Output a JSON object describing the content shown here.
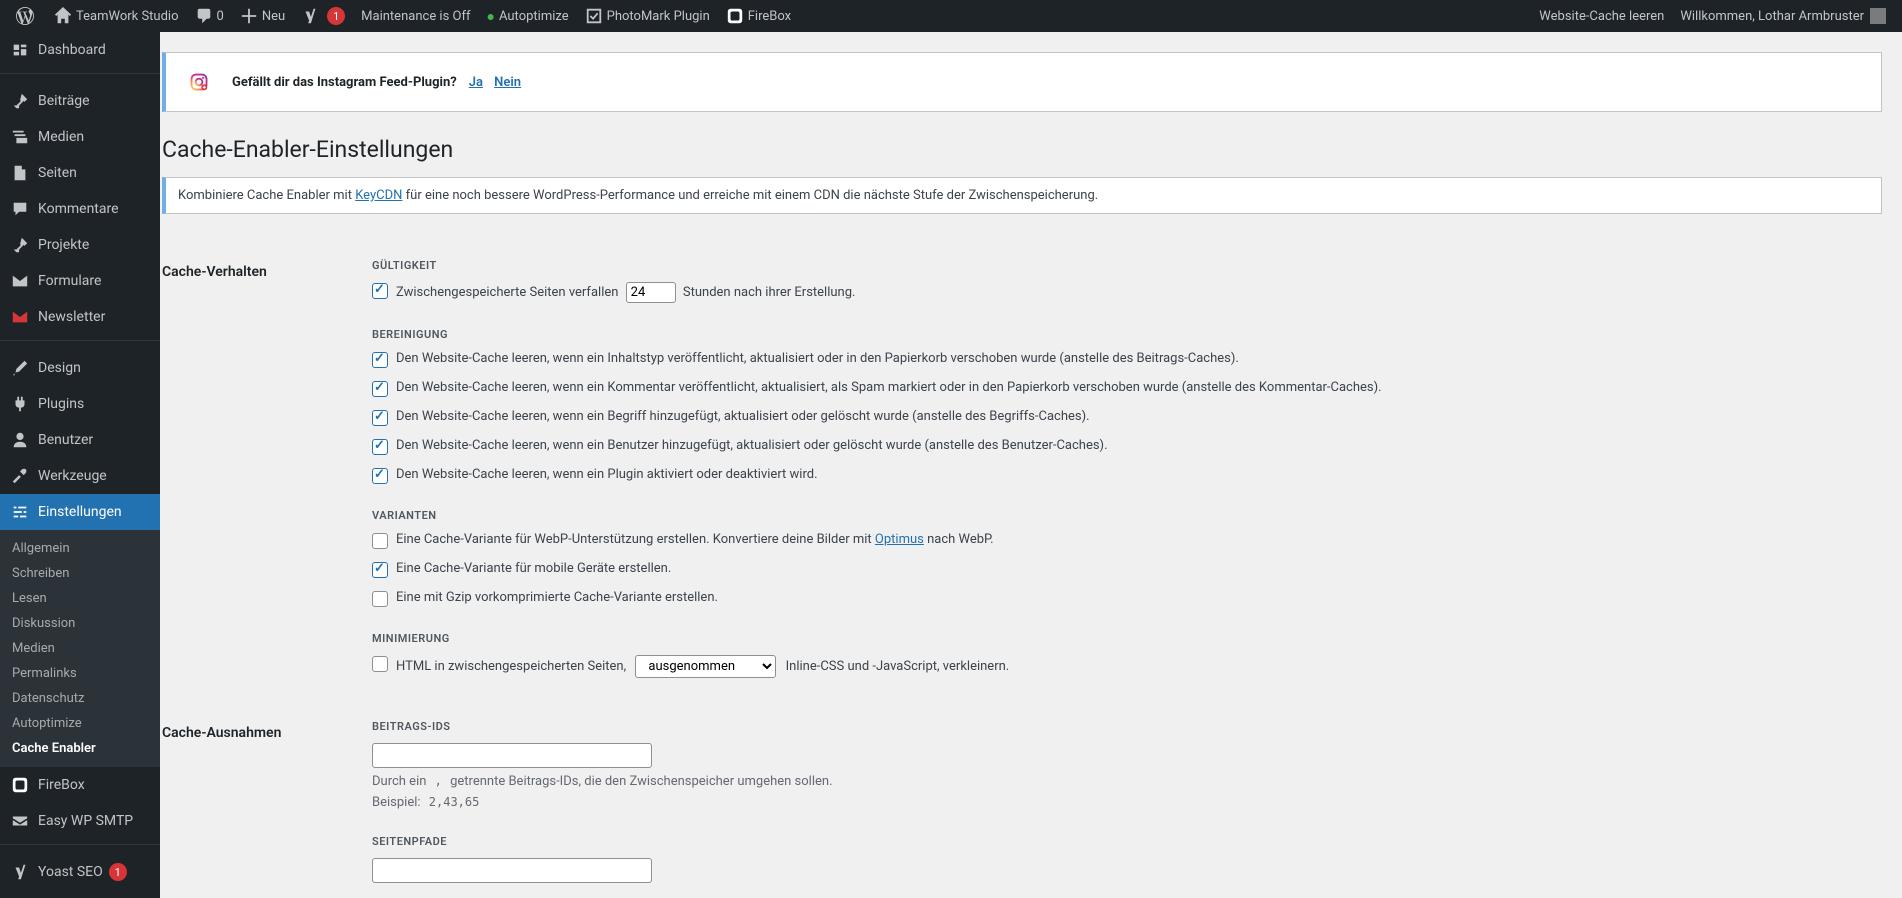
{
  "adminbar": {
    "site_name": "TeamWork Studio",
    "comments": "0",
    "new": "Neu",
    "yoast_badge": "1",
    "maintenance": "Maintenance is Off",
    "autoptimize": "Autoptimize",
    "photomark": "PhotoMark Plugin",
    "firebox": "FireBox",
    "cache_clear": "Website-Cache leeren",
    "welcome_prefix": "Willkommen, ",
    "welcome_name": "Lothar Armbruster"
  },
  "menu": {
    "dashboard": "Dashboard",
    "posts": "Beiträge",
    "media": "Medien",
    "pages": "Seiten",
    "comments": "Kommentare",
    "projects": "Projekte",
    "forms": "Formulare",
    "newsletter": "Newsletter",
    "design": "Design",
    "plugins": "Plugins",
    "users": "Benutzer",
    "tools": "Werkzeuge",
    "settings": "Einstellungen",
    "sub_general": "Allgemein",
    "sub_writing": "Schreiben",
    "sub_reading": "Lesen",
    "sub_discussion": "Diskussion",
    "sub_media": "Medien",
    "sub_permalinks": "Permalinks",
    "sub_privacy": "Datenschutz",
    "sub_autoptimize": "Autoptimize",
    "sub_cacheenabler": "Cache Enabler",
    "firebox": "FireBox",
    "easywpsmtp": "Easy WP SMTP",
    "yoast": "Yoast SEO",
    "yoast_badge": "1"
  },
  "notice": {
    "question": "Gefällt dir das Instagram Feed-Plugin?",
    "yes": "Ja",
    "no": "Nein"
  },
  "page_title": "Cache-Enabler-Einstellungen",
  "infobox": {
    "pre": "Kombiniere Cache Enabler mit ",
    "link": "KeyCDN",
    "post": " für eine noch bessere WordPress-Performance und erreiche mit einem CDN die nächste Stufe der Zwischenspeicherung."
  },
  "section1": {
    "heading": "Cache-Verhalten",
    "validity_h": "Gültigkeit",
    "validity_pre": "Zwischengespeicherte Seiten verfallen",
    "validity_value": "24",
    "validity_post": "Stunden nach ihrer Erstellung.",
    "clear_h": "Bereinigung",
    "c1": "Den Website-Cache leeren, wenn ein Inhaltstyp veröffentlicht, aktualisiert oder in den Papierkorb verschoben wurde (anstelle des Beitrags-Caches).",
    "c2": "Den Website-Cache leeren, wenn ein Kommentar veröffentlicht, aktualisiert, als Spam markiert oder in den Papierkorb verschoben wurde (anstelle des Kommentar-Caches).",
    "c3": "Den Website-Cache leeren, wenn ein Begriff hinzugefügt, aktualisiert oder gelöscht wurde (anstelle des Begriffs-Caches).",
    "c4": "Den Website-Cache leeren, wenn ein Benutzer hinzugefügt, aktualisiert oder gelöscht wurde (anstelle des Benutzer-Caches).",
    "c5": "Den Website-Cache leeren, wenn ein Plugin aktiviert oder deaktiviert wird.",
    "variants_h": "Varianten",
    "v1_pre": "Eine Cache-Variante für WebP-Unterstützung erstellen. Konvertiere deine Bilder mit ",
    "v1_link": "Optimus",
    "v1_post": " nach WebP.",
    "v2": "Eine Cache-Variante für mobile Geräte erstellen.",
    "v3": "Eine mit Gzip vorkomprimierte Cache-Variante erstellen.",
    "min_h": "Minimierung",
    "m_pre": "HTML in zwischengespeicherten Seiten,",
    "m_select": "ausgenommen",
    "m_post": "Inline-CSS und -JavaScript, verkleinern."
  },
  "section2": {
    "heading": "Cache-Ausnahmen",
    "postids_h": "Beitrags-IDs",
    "postids_value": "",
    "postids_desc_pre": "Durch ein ",
    "postids_desc_code": ",",
    "postids_desc_post": " getrennte Beitrags-IDs, die den Zwischenspeicher umgehen sollen.",
    "postids_ex_pre": "Beispiel: ",
    "postids_ex_code": "2,43,65",
    "paths_h": "Seitenpfade"
  }
}
